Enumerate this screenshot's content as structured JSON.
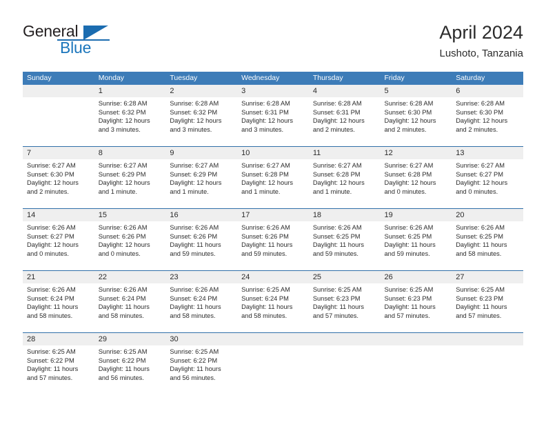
{
  "brand": {
    "word1": "General",
    "word2": "Blue",
    "logo_icon": "triangle-logo-icon"
  },
  "header": {
    "title": "April 2024",
    "subtitle": "Lushoto, Tanzania"
  },
  "calendar": {
    "weekdays": [
      "Sunday",
      "Monday",
      "Tuesday",
      "Wednesday",
      "Thursday",
      "Friday",
      "Saturday"
    ],
    "accent_color": "#3d7cb8",
    "separator_color": "#2f6ea8",
    "daynum_band_color": "#efefef",
    "weeks": [
      [
        {
          "day": "",
          "lines": []
        },
        {
          "day": "1",
          "lines": [
            "Sunrise: 6:28 AM",
            "Sunset: 6:32 PM",
            "Daylight: 12 hours",
            "and 3 minutes."
          ]
        },
        {
          "day": "2",
          "lines": [
            "Sunrise: 6:28 AM",
            "Sunset: 6:32 PM",
            "Daylight: 12 hours",
            "and 3 minutes."
          ]
        },
        {
          "day": "3",
          "lines": [
            "Sunrise: 6:28 AM",
            "Sunset: 6:31 PM",
            "Daylight: 12 hours",
            "and 3 minutes."
          ]
        },
        {
          "day": "4",
          "lines": [
            "Sunrise: 6:28 AM",
            "Sunset: 6:31 PM",
            "Daylight: 12 hours",
            "and 2 minutes."
          ]
        },
        {
          "day": "5",
          "lines": [
            "Sunrise: 6:28 AM",
            "Sunset: 6:30 PM",
            "Daylight: 12 hours",
            "and 2 minutes."
          ]
        },
        {
          "day": "6",
          "lines": [
            "Sunrise: 6:28 AM",
            "Sunset: 6:30 PM",
            "Daylight: 12 hours",
            "and 2 minutes."
          ]
        }
      ],
      [
        {
          "day": "7",
          "lines": [
            "Sunrise: 6:27 AM",
            "Sunset: 6:30 PM",
            "Daylight: 12 hours",
            "and 2 minutes."
          ]
        },
        {
          "day": "8",
          "lines": [
            "Sunrise: 6:27 AM",
            "Sunset: 6:29 PM",
            "Daylight: 12 hours",
            "and 1 minute."
          ]
        },
        {
          "day": "9",
          "lines": [
            "Sunrise: 6:27 AM",
            "Sunset: 6:29 PM",
            "Daylight: 12 hours",
            "and 1 minute."
          ]
        },
        {
          "day": "10",
          "lines": [
            "Sunrise: 6:27 AM",
            "Sunset: 6:28 PM",
            "Daylight: 12 hours",
            "and 1 minute."
          ]
        },
        {
          "day": "11",
          "lines": [
            "Sunrise: 6:27 AM",
            "Sunset: 6:28 PM",
            "Daylight: 12 hours",
            "and 1 minute."
          ]
        },
        {
          "day": "12",
          "lines": [
            "Sunrise: 6:27 AM",
            "Sunset: 6:28 PM",
            "Daylight: 12 hours",
            "and 0 minutes."
          ]
        },
        {
          "day": "13",
          "lines": [
            "Sunrise: 6:27 AM",
            "Sunset: 6:27 PM",
            "Daylight: 12 hours",
            "and 0 minutes."
          ]
        }
      ],
      [
        {
          "day": "14",
          "lines": [
            "Sunrise: 6:26 AM",
            "Sunset: 6:27 PM",
            "Daylight: 12 hours",
            "and 0 minutes."
          ]
        },
        {
          "day": "15",
          "lines": [
            "Sunrise: 6:26 AM",
            "Sunset: 6:26 PM",
            "Daylight: 12 hours",
            "and 0 minutes."
          ]
        },
        {
          "day": "16",
          "lines": [
            "Sunrise: 6:26 AM",
            "Sunset: 6:26 PM",
            "Daylight: 11 hours",
            "and 59 minutes."
          ]
        },
        {
          "day": "17",
          "lines": [
            "Sunrise: 6:26 AM",
            "Sunset: 6:26 PM",
            "Daylight: 11 hours",
            "and 59 minutes."
          ]
        },
        {
          "day": "18",
          "lines": [
            "Sunrise: 6:26 AM",
            "Sunset: 6:25 PM",
            "Daylight: 11 hours",
            "and 59 minutes."
          ]
        },
        {
          "day": "19",
          "lines": [
            "Sunrise: 6:26 AM",
            "Sunset: 6:25 PM",
            "Daylight: 11 hours",
            "and 59 minutes."
          ]
        },
        {
          "day": "20",
          "lines": [
            "Sunrise: 6:26 AM",
            "Sunset: 6:25 PM",
            "Daylight: 11 hours",
            "and 58 minutes."
          ]
        }
      ],
      [
        {
          "day": "21",
          "lines": [
            "Sunrise: 6:26 AM",
            "Sunset: 6:24 PM",
            "Daylight: 11 hours",
            "and 58 minutes."
          ]
        },
        {
          "day": "22",
          "lines": [
            "Sunrise: 6:26 AM",
            "Sunset: 6:24 PM",
            "Daylight: 11 hours",
            "and 58 minutes."
          ]
        },
        {
          "day": "23",
          "lines": [
            "Sunrise: 6:26 AM",
            "Sunset: 6:24 PM",
            "Daylight: 11 hours",
            "and 58 minutes."
          ]
        },
        {
          "day": "24",
          "lines": [
            "Sunrise: 6:25 AM",
            "Sunset: 6:24 PM",
            "Daylight: 11 hours",
            "and 58 minutes."
          ]
        },
        {
          "day": "25",
          "lines": [
            "Sunrise: 6:25 AM",
            "Sunset: 6:23 PM",
            "Daylight: 11 hours",
            "and 57 minutes."
          ]
        },
        {
          "day": "26",
          "lines": [
            "Sunrise: 6:25 AM",
            "Sunset: 6:23 PM",
            "Daylight: 11 hours",
            "and 57 minutes."
          ]
        },
        {
          "day": "27",
          "lines": [
            "Sunrise: 6:25 AM",
            "Sunset: 6:23 PM",
            "Daylight: 11 hours",
            "and 57 minutes."
          ]
        }
      ],
      [
        {
          "day": "28",
          "lines": [
            "Sunrise: 6:25 AM",
            "Sunset: 6:22 PM",
            "Daylight: 11 hours",
            "and 57 minutes."
          ]
        },
        {
          "day": "29",
          "lines": [
            "Sunrise: 6:25 AM",
            "Sunset: 6:22 PM",
            "Daylight: 11 hours",
            "and 56 minutes."
          ]
        },
        {
          "day": "30",
          "lines": [
            "Sunrise: 6:25 AM",
            "Sunset: 6:22 PM",
            "Daylight: 11 hours",
            "and 56 minutes."
          ]
        },
        {
          "day": "",
          "lines": []
        },
        {
          "day": "",
          "lines": []
        },
        {
          "day": "",
          "lines": []
        },
        {
          "day": "",
          "lines": []
        }
      ]
    ]
  }
}
